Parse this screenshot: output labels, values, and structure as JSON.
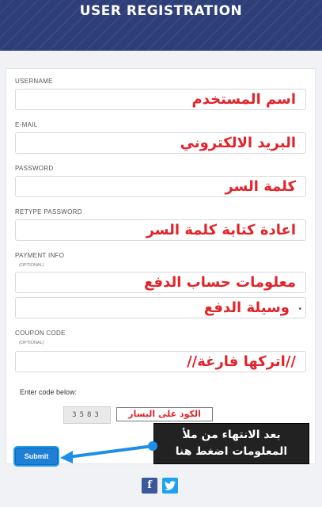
{
  "header": {
    "title": "USER REGISTRATION"
  },
  "form": {
    "username": {
      "label": "USERNAME",
      "value": "اسم المستخدم"
    },
    "email": {
      "label": "E-MAIL",
      "value": "البريد الالكتروني"
    },
    "password": {
      "label": "PASSWORD",
      "value": "كلمة السر"
    },
    "retype_password": {
      "label": "RETYPE PASSWORD",
      "value": "اعادة كتابة كلمة السر"
    },
    "payment_info": {
      "label": "PAYMENT INFO",
      "optional": "(OPTIONAL)",
      "value": "معلومات حساب الدفع"
    },
    "payment_method": {
      "value": "وسيلة الدفع",
      "arrow": "▾"
    },
    "coupon": {
      "label": "COUPON CODE",
      "optional": "(OPTIONAL)",
      "value": "//اتركها فارغة//"
    },
    "code_label": "Enter code below:",
    "captcha_code": "3583",
    "captcha_hint": "الكود على اليسار",
    "submit_label": "Submit"
  },
  "callout": {
    "line1": "بعد الانتهاء من ملأ",
    "line2": "المعلومات اضغط هنا"
  },
  "social": {
    "facebook": "f",
    "twitter": "🐦"
  },
  "colors": {
    "header": "#2d3e78",
    "accent": "#1e7fd6",
    "annotation_red": "#e2242a"
  }
}
